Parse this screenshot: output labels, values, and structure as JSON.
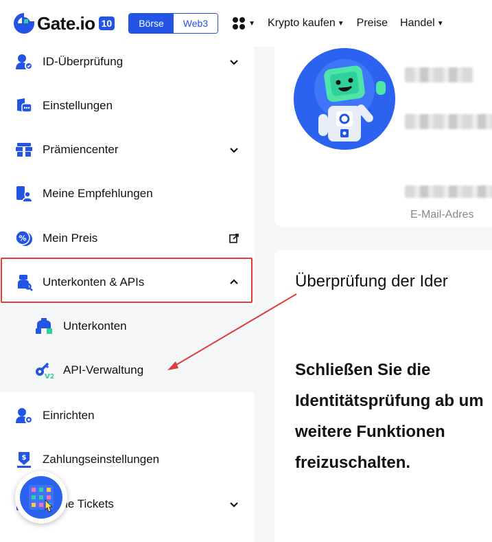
{
  "header": {
    "logo_text": "Gate.io",
    "logo_badge": "10",
    "mode_tabs": [
      {
        "label": "Börse",
        "active": true
      },
      {
        "label": "Web3",
        "active": false
      }
    ],
    "apps_icon": "apps-grid-icon",
    "nav": [
      {
        "label": "Krypto kaufen",
        "dropdown": true
      },
      {
        "label": "Preise",
        "dropdown": false
      },
      {
        "label": "Handel",
        "dropdown": true
      }
    ]
  },
  "sidebar": {
    "items": [
      {
        "label": "ID-Überprüfung",
        "icon": "id-verify-icon",
        "chevron": "down"
      },
      {
        "label": "Einstellungen",
        "icon": "settings-icon"
      },
      {
        "label": "Prämiencenter",
        "icon": "rewards-icon",
        "chevron": "down"
      },
      {
        "label": "Meine Empfehlungen",
        "icon": "referral-icon"
      },
      {
        "label": "Mein Preis",
        "icon": "percent-icon",
        "external": true
      },
      {
        "label": "Unterkonten & APIs",
        "icon": "subaccount-api-icon",
        "chevron": "up",
        "highlighted": true
      },
      {
        "label": "Einrichten",
        "icon": "setup-icon"
      },
      {
        "label": "Zahlungseinstellungen",
        "icon": "payment-icon"
      },
      {
        "label": "Meine Tickets",
        "icon": "ticket-icon",
        "chevron": "down"
      }
    ],
    "subitems": [
      {
        "label": "Unterkonten",
        "icon": "subaccounts-icon"
      },
      {
        "label": "API-Verwaltung",
        "icon": "api-key-v2-icon"
      }
    ]
  },
  "main": {
    "email_label": "E-Mail-Adres",
    "verify_title": "Überprüfung der Ider",
    "verify_text": "Schließen Sie die Identitätsprüfung ab um weitere Funktionen freizuschalten."
  },
  "colors": {
    "brand_blue": "#2354e6",
    "highlight_red": "#e03c3c",
    "icon_blue": "#2354e6",
    "accent_green": "#2fd09a"
  }
}
